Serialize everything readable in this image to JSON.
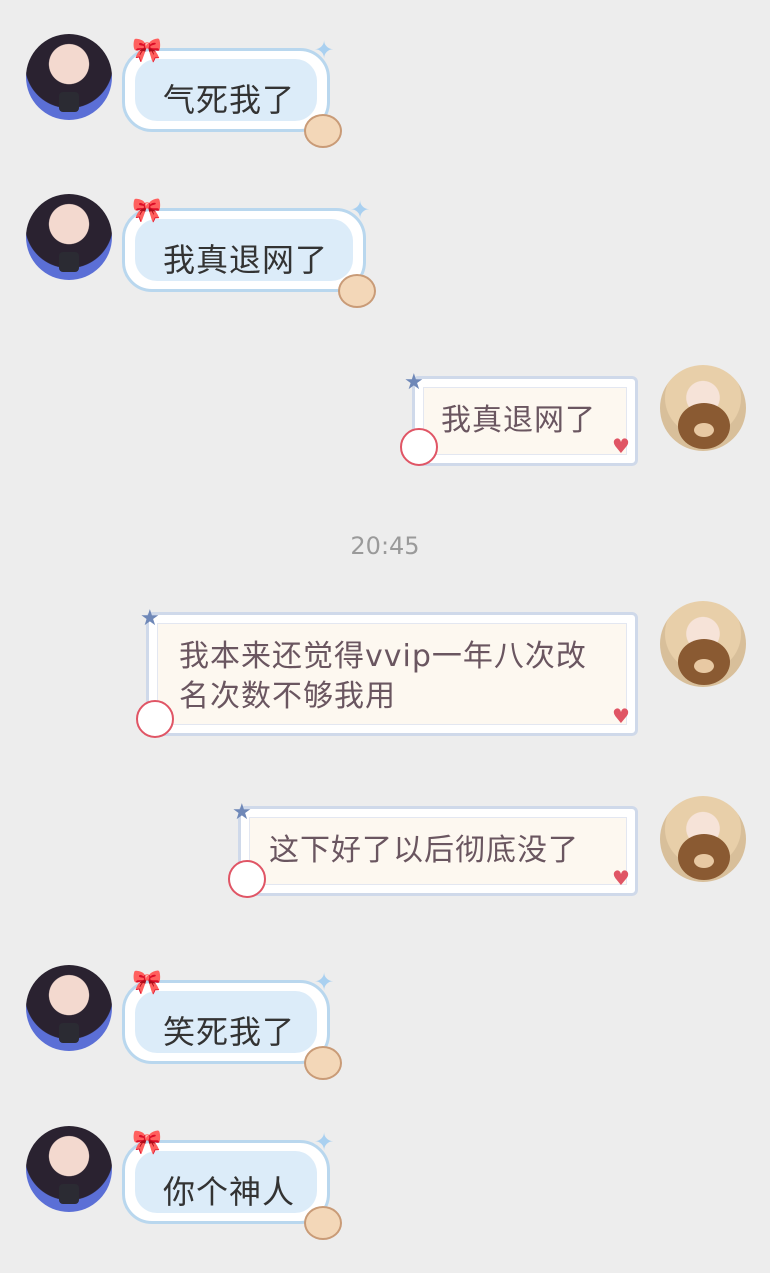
{
  "messages": [
    {
      "side": "left",
      "text": "气死我了"
    },
    {
      "side": "left",
      "text": "我真退网了"
    },
    {
      "side": "right",
      "text": "我真退网了"
    },
    {
      "side": "right",
      "text": "我本来还觉得vvip一年八次改名次数不够我用"
    },
    {
      "side": "right",
      "text": "这下好了以后彻底没了"
    },
    {
      "side": "left",
      "text": "笑死我了"
    },
    {
      "side": "left",
      "text": "你个神人"
    }
  ],
  "timestamp": "20:45",
  "colors": {
    "background": "#ededed",
    "left_bubble": "#dcecf9",
    "left_border": "#b9d7ee",
    "right_bubble": "#fdf8f0",
    "right_text": "#6a5660"
  },
  "icons": [
    "boy-avatar",
    "girl-avatar-bear",
    "ribbon-bow-icon",
    "sparkle-icon",
    "deer-sticker-icon",
    "hello-kitty-sticker-icon",
    "star-icon",
    "love-note-icon"
  ]
}
